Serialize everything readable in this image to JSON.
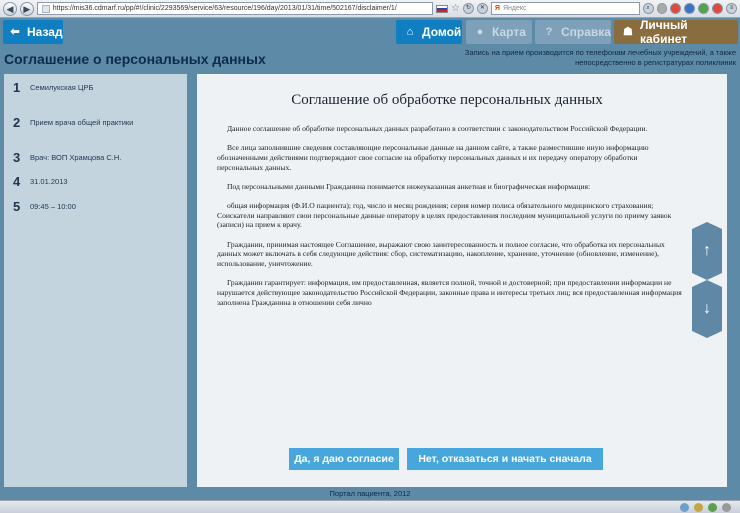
{
  "browser": {
    "url": "https://mis36.cdmarf.ru/pp/#!/clinic/2293569/service/63/resource/196/day/2013/01/31/time/502167/disclaimer/1/",
    "search_engine": "Яндекс",
    "search_brand": "Я"
  },
  "nav": {
    "back_label": "Назад",
    "home_label": "Домой",
    "map_label": "Карта",
    "help_label": "Справка",
    "cabinet_label": "Личный кабинет",
    "help_glyph": "?"
  },
  "header": {
    "title": "Соглашение о персональных данных",
    "notice": "Запись на прием производится по телефонам лечебных учреждений, а также непосредственно в регистратурах поликлиник"
  },
  "steps": [
    {
      "num": "1",
      "label": "Семилукская ЦРБ"
    },
    {
      "num": "2",
      "label": "Прием врача общей практики"
    },
    {
      "num": "3",
      "label": "Врач: ВОП Храмцова С.Н."
    },
    {
      "num": "4",
      "label": "31.01.2013"
    },
    {
      "num": "5",
      "label": "09:45 – 10:00"
    }
  ],
  "document": {
    "title": "Соглашение об обработке персональных данных",
    "paragraphs": [
      "Данное соглашение об обработке персональных данных разработано в соответствии с законодательством Российской Федерации.",
      "Все лица заполнившие сведения составляющие персональные данные на данном сайте, а также разместившие иную информацию обозначенными действиями подтверждают свое согласие на обработку персональных данных и их передачу оператору обработки персональных данных.",
      "Под персональными данными Гражданина понимается нижеуказанная анкетная и биографическая информация:",
      "общая информация (Ф.И.О пациента); год, число и месяц рождения; серия номер полиса обязательного медицинского страхования; Соискатели направляют свои персональные данные оператору в целях предоставления последним муниципальной услуги по приему заявок (записи) на прием к врачу.",
      "Гражданин, принимая настоящее Соглашение, выражают свою заинтересованность и полное согласие, что обработка их персональных данных может включать в себя следующие действия: сбор, систематизацию, накопление, хранение, уточнение (обновление, изменение), использование, уничтожение.",
      "Гражданин гарантирует: информация, им предоставленная, является полной, точной и достоверной; при предоставлении информации не нарушается действующее законодательство Российской Федерации, законные права и интересы третьих лиц; вся предоставленная информация заполнена Гражданина в отношении себя лично"
    ]
  },
  "actions": {
    "agree_label": "Да, я даю согласие",
    "decline_label": "Нет, отказаться и начать сначала"
  },
  "footer": {
    "text": "Портал пациента, 2012"
  },
  "colors": {
    "primary_button": "#0f7fc2",
    "disabled_button": "#7ea0b8",
    "cabinet_button": "#8a6d3f",
    "action_button": "#47a6db"
  }
}
